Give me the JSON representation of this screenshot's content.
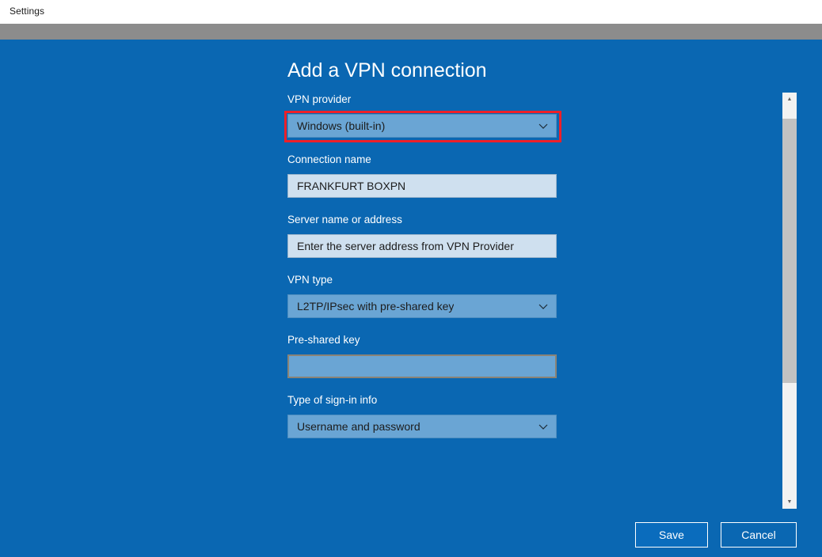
{
  "window": {
    "title": "Settings"
  },
  "page": {
    "heading": "Add a VPN connection"
  },
  "colors": {
    "background_blue": "#0a67b2",
    "dropdown_fill": "#6aa5d4",
    "textbox_fill": "#cfe0ef",
    "highlight_red": "#ee2029",
    "titlebar": "#ffffff",
    "gray_band": "#8c8c8c",
    "button_text": "#ffffff"
  },
  "form": {
    "fields": [
      {
        "label": "VPN provider",
        "type": "dropdown",
        "value": "Windows (built-in)",
        "icon": "chevron-down-icon",
        "highlighted": true
      },
      {
        "label": "Connection name",
        "type": "textbox",
        "value": "FRANKFURT BOXPN",
        "placeholder": "Connection name"
      },
      {
        "label": "Server name or address",
        "type": "textbox",
        "value": "Enter the server address from VPN Provider",
        "placeholder": "Enter the server address from VPN Provider"
      },
      {
        "label": "VPN type",
        "type": "dropdown",
        "value": "L2TP/IPsec with pre-shared key",
        "icon": "chevron-down-icon"
      },
      {
        "label": "Pre-shared key",
        "type": "password",
        "value": "",
        "placeholder": ""
      },
      {
        "label": "Type of sign-in info",
        "type": "dropdown",
        "value": "Username and password",
        "icon": "chevron-down-icon"
      }
    ]
  },
  "scrollbar": {
    "up_arrow": "▲",
    "down_arrow": "▼"
  },
  "footer": {
    "save_label": "Save",
    "cancel_label": "Cancel"
  }
}
